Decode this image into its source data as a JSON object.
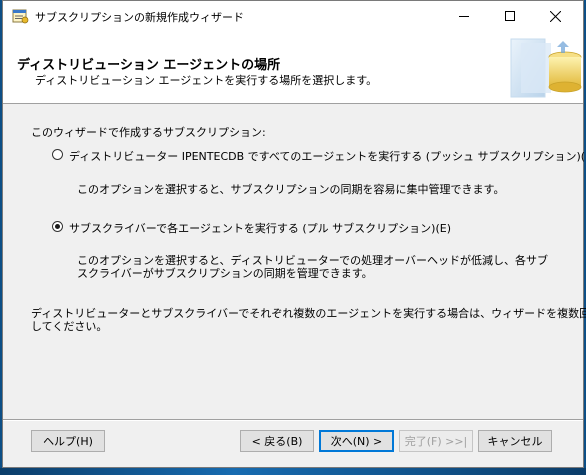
{
  "window": {
    "title": "サブスクリプションの新規作成ウィザード"
  },
  "header": {
    "title": "ディストリビューション エージェントの場所",
    "subtitle": "ディストリビューション エージェントを実行する場所を選択します。"
  },
  "content": {
    "prompt": "このウィザードで作成するサブスクリプション:",
    "options": [
      {
        "label": "ディストリビューター IPENTECDB ですべてのエージェントを実行する (プッシュ サブスクリプション)(R)",
        "description_lines": [
          "このオプションを選択すると、サブスクリプションの同期を容易に集中管理できます。"
        ],
        "selected": false
      },
      {
        "label": "サブスクライバーで各エージェントを実行する (プル サブスクリプション)(E)",
        "description_lines": [
          "このオプションを選択すると、ディストリビューターでの処理オーバーヘッドが低減し、各サブ",
          "スクライバーがサブスクリプションの同期を管理できます。"
        ],
        "selected": true
      }
    ],
    "note_lines": [
      "ディストリビューターとサブスクライバーでそれぞれ複数のエージェントを実行する場合は、ウィザードを複数回実行",
      "してください。"
    ]
  },
  "buttons": {
    "help": "ヘルプ(H)",
    "back": "< 戻る(B)",
    "next": "次へ(N) >",
    "finish": "完了(F) >>|",
    "cancel": "キャンセル"
  },
  "icons": {
    "app": "wizard-app-icon",
    "header": "database-wizard-graphic"
  }
}
